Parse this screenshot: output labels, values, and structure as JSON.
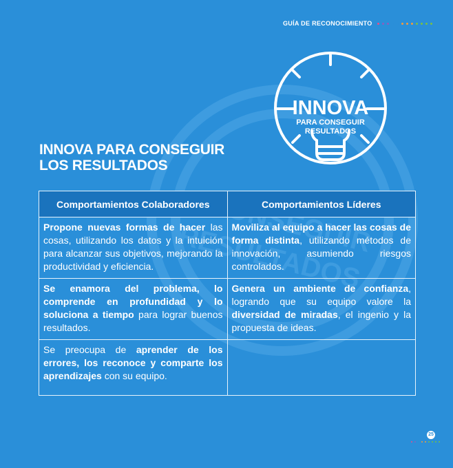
{
  "header": {
    "label": "GUÍA DE RECONOCIMIENTO",
    "dot_colors": [
      "#e84e8a",
      "#8b5fbf",
      "#8b5fbf",
      "#2a8fd9",
      "#2a8fd9",
      "#f39c3b",
      "#f39c3b",
      "#f39c3b",
      "#7ac143",
      "#7ac143",
      "#7ac143",
      "#7ac143"
    ]
  },
  "badge": {
    "title": "INNOVA",
    "subtitle_line1": "PARA CONSEGUIR",
    "subtitle_line2": "RESULTADOS"
  },
  "section_title": {
    "line1": "INNOVA PARA CONSEGUIR",
    "line2": "LOS RESULTADOS"
  },
  "table": {
    "headers": [
      "Comportamientos Colaboradores",
      "Comportamientos Líderes"
    ],
    "rows": [
      [
        [
          {
            "b": true,
            "t": "Propone nuevas formas de hacer"
          },
          {
            "b": false,
            "t": " las cosas, utilizando los datos y la intuición para alcanzar sus objetivos, mejorando la productividad y eficiencia."
          }
        ],
        [
          {
            "b": true,
            "t": "Moviliza al equipo a hacer las cosas de forma distinta"
          },
          {
            "b": false,
            "t": ", utilizando métodos de innovación, asumiendo riesgos controlados."
          }
        ]
      ],
      [
        [
          {
            "b": true,
            "t": "Se enamora del problema, lo comprende en profundidad y lo soluciona a tiempo"
          },
          {
            "b": false,
            "t": " para lograr buenos resultados."
          }
        ],
        [
          {
            "b": true,
            "t": "Genera un ambiente de confianza"
          },
          {
            "b": false,
            "t": ", logrando que su equipo valore la "
          },
          {
            "b": true,
            "t": "diversidad de miradas"
          },
          {
            "b": false,
            "t": ", el ingenio y la propuesta de ideas."
          }
        ]
      ],
      [
        [
          {
            "b": false,
            "t": "Se preocupa de "
          },
          {
            "b": true,
            "t": "aprender de los errores, los reconoce y comparte los aprendizajes"
          },
          {
            "b": false,
            "t": " con su equipo."
          }
        ],
        []
      ]
    ]
  },
  "footer": {
    "page_number": "25",
    "dot_colors": [
      "#e84e8a",
      "#8b5fbf",
      "#2a8fd9",
      "#f39c3b",
      "#f39c3b",
      "#7ac143",
      "#7ac143",
      "#7ac143",
      "#7ac143"
    ]
  }
}
